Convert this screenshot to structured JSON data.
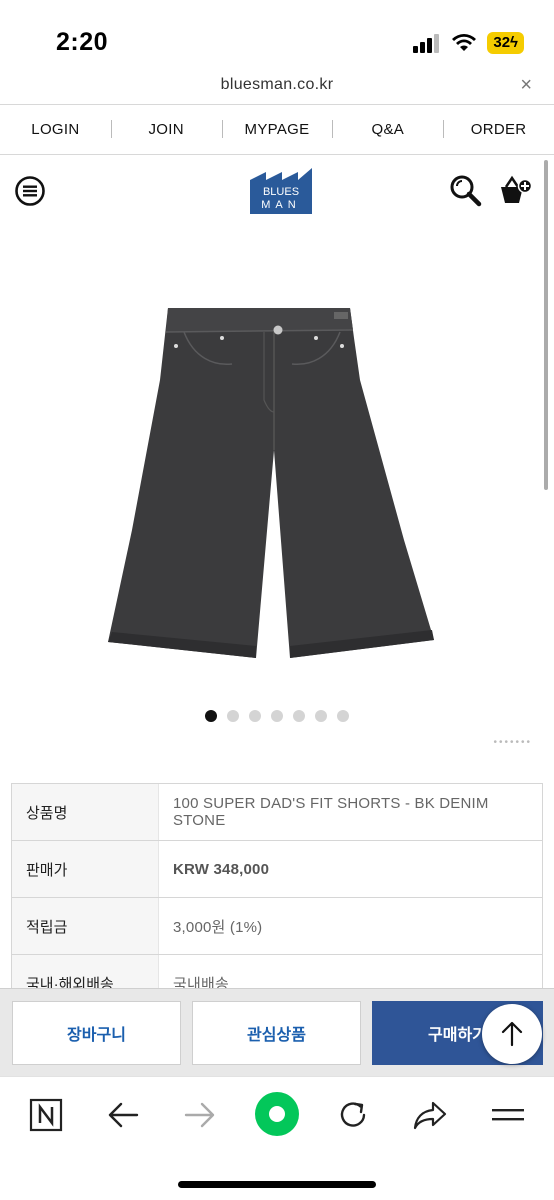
{
  "status": {
    "time": "2:20",
    "battery": "32"
  },
  "browser": {
    "url": "bluesman.co.kr",
    "close": "×"
  },
  "top_nav": [
    "LOGIN",
    "JOIN",
    "MYPAGE",
    "Q&A",
    "ORDER"
  ],
  "logo": {
    "line1": "BLUES",
    "line2": "MAN",
    "color": "#2a5a9a"
  },
  "gallery": {
    "total": 7,
    "active": 1
  },
  "product_info": [
    {
      "label": "상품명",
      "value": "100 SUPER DAD'S FIT SHORTS - BK DENIM STONE",
      "bold": false
    },
    {
      "label": "판매가",
      "value": "KRW 348,000",
      "bold": true
    },
    {
      "label": "적립금",
      "value": "3,000원 (1%)",
      "bold": false
    },
    {
      "label": "국내·해외배송",
      "value": "국내배송",
      "bold": false
    }
  ],
  "actions": {
    "cart": "장바구니",
    "wish": "관심상품",
    "buy": "구매하기"
  },
  "colors": {
    "accent": "#2f5597",
    "link": "#1b5fae",
    "home": "#03c75a"
  }
}
